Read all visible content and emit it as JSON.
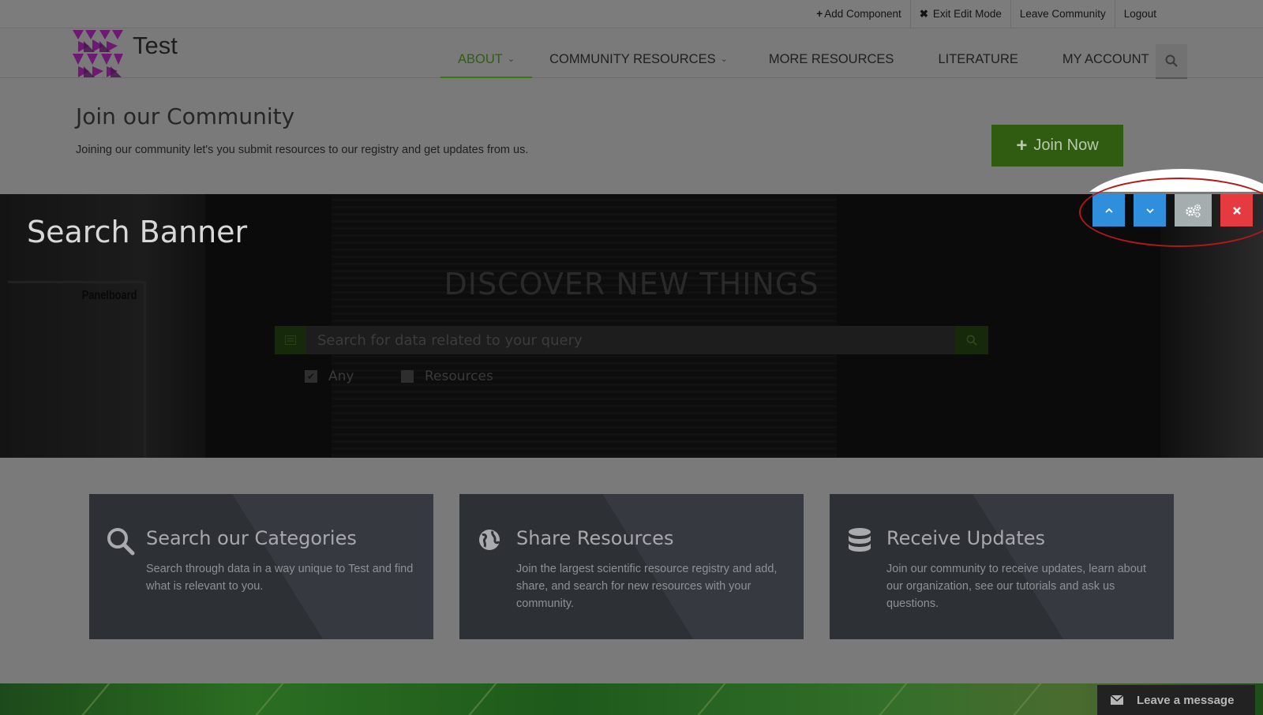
{
  "topbar": {
    "links": [
      {
        "icon": "plus-icon",
        "symbol": "+",
        "label": "Add Component"
      },
      {
        "icon": "x-icon",
        "symbol": "✖",
        "label": "Exit Edit Mode"
      },
      {
        "label": "Leave Community"
      },
      {
        "label": "Logout"
      }
    ]
  },
  "header": {
    "site_name": "Test",
    "nav": [
      {
        "label": "ABOUT",
        "active": true,
        "dropdown": true
      },
      {
        "label": "COMMUNITY RESOURCES",
        "active": false,
        "dropdown": true
      },
      {
        "label": "MORE RESOURCES",
        "active": false,
        "dropdown": false
      },
      {
        "label": "LITERATURE",
        "active": false,
        "dropdown": false
      },
      {
        "label": "MY ACCOUNT",
        "active": false,
        "dropdown": true
      }
    ]
  },
  "join": {
    "title": "Join our Community",
    "description": "Joining our community let's you submit resources to our registry and get updates from us.",
    "button_label": "Join Now"
  },
  "banner": {
    "component_title": "Search Banner",
    "headline": "DISCOVER NEW THINGS",
    "search_placeholder": "Search for data related to your query",
    "filters": [
      {
        "label": "Any",
        "checked": true
      },
      {
        "label": "Resources",
        "checked": false
      }
    ],
    "background_sign": "Panelboard"
  },
  "features": [
    {
      "icon": "search-icon",
      "title": "Search our Categories",
      "text": "Search through data in a way unique to Test and find what is relevant to you."
    },
    {
      "icon": "globe-icon",
      "title": "Share Resources",
      "text": "Join the largest scientific resource registry and add, share, and search for new resources with your community."
    },
    {
      "icon": "database-icon",
      "title": "Receive Updates",
      "text": "Join our community to receive updates, learn about our organization, see our tutorials and ask us questions."
    }
  ],
  "chat": {
    "label": "Leave a message"
  },
  "colors": {
    "accent_green": "#5aa02c",
    "control_blue": "#2f8fdc",
    "control_red": "#e53a3f",
    "highlight_ring": "#b11818"
  }
}
